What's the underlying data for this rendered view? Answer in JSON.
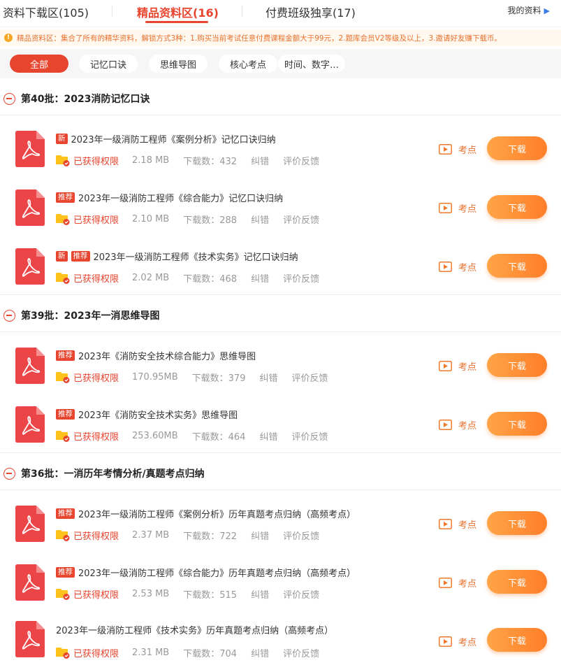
{
  "tabs": [
    {
      "label": "资料下载区(105)",
      "active": false
    },
    {
      "label": "精品资料区(16)",
      "active": true
    },
    {
      "label": "付费班级独享(17)",
      "active": false
    }
  ],
  "my_link": "我的资料",
  "notice": {
    "icon": "!",
    "text": "精品资料区：集合了所有的精华资料，解锁方式3种：1.购买当前考试任意付费课程金额大于99元，2.题库会员V2等级及以上，3.邀请好友赚下载币。"
  },
  "filters": [
    {
      "label": "全部",
      "active": true
    },
    {
      "label": "记忆口诀",
      "active": false
    },
    {
      "label": "思维导图",
      "active": false
    },
    {
      "label": "核心考点",
      "active": false
    },
    {
      "label": "时间、数字…",
      "active": false
    }
  ],
  "item_labels": {
    "permission": "已获得权限",
    "downloads_prefix": "下载数：",
    "report_error": "纠错",
    "feedback": "评价反馈",
    "key_points": "考点",
    "download_button": "下载"
  },
  "colors": {
    "accent": "#e8452f",
    "button_start": "#ffa447",
    "button_end": "#ff7e29",
    "pdf_icon": "#ec4548"
  },
  "sections": [
    {
      "title": "第40批：2023消防记忆口诀",
      "items": [
        {
          "badges": [
            "新"
          ],
          "title": "2023年一级消防工程师《案例分析》记忆口诀归纳",
          "size": "2.18 MB",
          "downloads": "432"
        },
        {
          "badges": [
            "推荐"
          ],
          "title": "2023年一级消防工程师《综合能力》记忆口诀归纳",
          "size": "2.10 MB",
          "downloads": "288"
        },
        {
          "badges": [
            "新",
            "推荐"
          ],
          "title": "2023年一级消防工程师《技术实务》记忆口诀归纳",
          "size": "2.02 MB",
          "downloads": "468"
        }
      ]
    },
    {
      "title": "第39批：2023年一消思维导图",
      "items": [
        {
          "badges": [
            "推荐"
          ],
          "title": "2023年《消防安全技术综合能力》思维导图",
          "size": "170.95MB",
          "downloads": "379"
        },
        {
          "badges": [
            "推荐"
          ],
          "title": "2023年《消防安全技术实务》思维导图",
          "size": "253.60MB",
          "downloads": "464"
        }
      ]
    },
    {
      "title": "第36批：一消历年考情分析/真题考点归纳",
      "items": [
        {
          "badges": [
            "推荐"
          ],
          "title": "2023年一级消防工程师《案例分析》历年真题考点归纳（高频考点）",
          "size": "2.37 MB",
          "downloads": "722"
        },
        {
          "badges": [
            "推荐"
          ],
          "title": "2023年一级消防工程师《综合能力》历年真题考点归纳（高频考点）",
          "size": "2.53 MB",
          "downloads": "515"
        },
        {
          "badges": [],
          "title": "2023年一级消防工程师《技术实务》历年真题考点归纳（高频考点）",
          "size": "2.31 MB",
          "downloads": "704"
        }
      ]
    }
  ]
}
